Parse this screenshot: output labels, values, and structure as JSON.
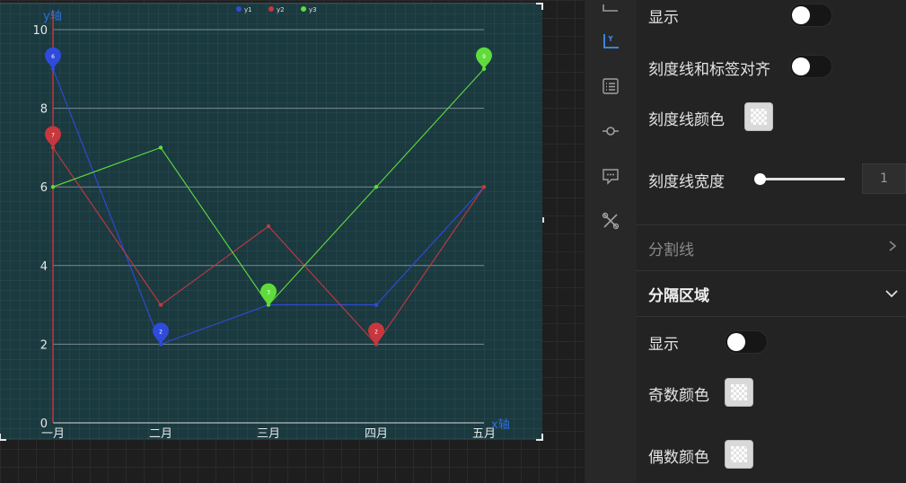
{
  "chart_data": {
    "type": "line",
    "categories": [
      "一月",
      "二月",
      "三月",
      "四月",
      "五月"
    ],
    "series": [
      {
        "name": "y1",
        "values": [
          9,
          2,
          3,
          3,
          6
        ],
        "color": "#2f4bdc",
        "markers": [
          {
            "index": 0,
            "label": "6"
          },
          {
            "index": 1,
            "label": "2"
          }
        ]
      },
      {
        "name": "y2",
        "values": [
          7,
          3,
          5,
          2,
          6
        ],
        "color": "#c8373d",
        "markers": [
          {
            "index": 0,
            "label": "7"
          },
          {
            "index": 3,
            "label": "2"
          }
        ]
      },
      {
        "name": "y3",
        "values": [
          6,
          7,
          3,
          6,
          9
        ],
        "color": "#5fdc3c",
        "markers": [
          {
            "index": 2,
            "label": "3"
          },
          {
            "index": 4,
            "label": "9"
          }
        ]
      }
    ],
    "xlabel": "x轴",
    "ylabel": "y轴",
    "ylim": [
      0,
      10
    ],
    "yticks": [
      "0",
      "2",
      "4",
      "6",
      "8",
      "10"
    ],
    "grid": true,
    "legend_position": "top-center",
    "colors": {
      "background": "#1a3a40",
      "axis": "#c8373d",
      "axis_label": "#2f6fdc",
      "grid": "#9aa8aa"
    }
  },
  "panel": {
    "show_label_1": "显示",
    "tick_align_label": "刻度线和标签对齐",
    "tick_color_label": "刻度线颜色",
    "tick_width_label": "刻度线宽度",
    "tick_width_value": "1",
    "split_line_label": "分割线",
    "split_area_label": "分隔区域",
    "show_label_2": "显示",
    "odd_color_label": "奇数颜色",
    "even_color_label": "偶数颜色"
  }
}
